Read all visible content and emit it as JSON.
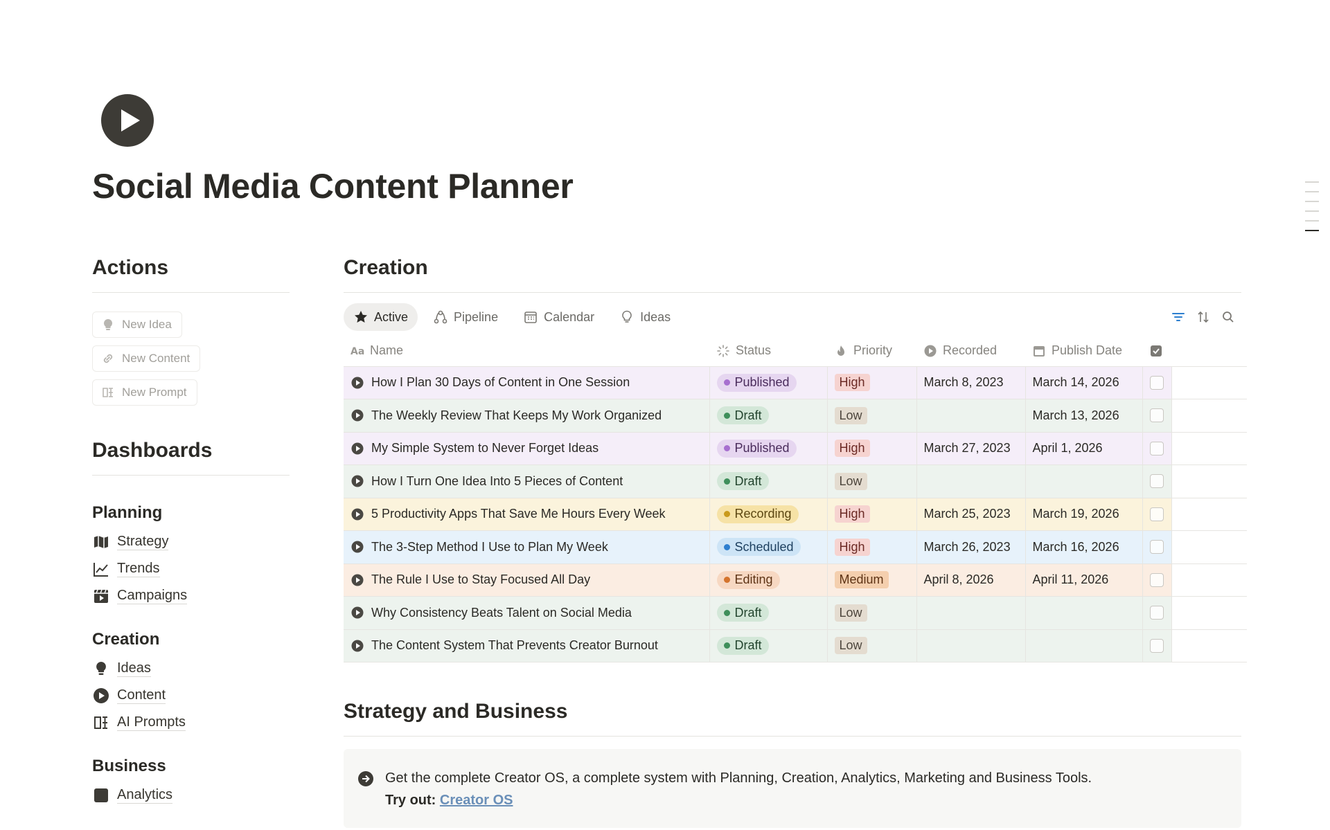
{
  "page": {
    "title": "Social Media Content Planner",
    "icon": "play-circle-icon"
  },
  "actions": {
    "heading": "Actions",
    "buttons": [
      {
        "label": "New Idea",
        "icon": "lightbulb-icon"
      },
      {
        "label": "New Content",
        "icon": "link-icon"
      },
      {
        "label": "New Prompt",
        "icon": "prompt-icon"
      }
    ]
  },
  "dashboards": {
    "heading": "Dashboards",
    "sections": [
      {
        "title": "Planning",
        "links": [
          {
            "label": "Strategy",
            "icon": "map-icon"
          },
          {
            "label": "Trends",
            "icon": "trend-up-icon"
          },
          {
            "label": "Campaigns",
            "icon": "clapperboard-icon"
          }
        ]
      },
      {
        "title": "Creation",
        "links": [
          {
            "label": "Ideas",
            "icon": "lightbulb-icon"
          },
          {
            "label": "Content",
            "icon": "play-circle-icon"
          },
          {
            "label": "AI Prompts",
            "icon": "prompt-icon"
          }
        ]
      },
      {
        "title": "Business",
        "links": [
          {
            "label": "Analytics",
            "icon": "chart-icon"
          }
        ]
      }
    ]
  },
  "creation": {
    "heading": "Creation",
    "views": [
      {
        "label": "Active",
        "icon": "star-icon",
        "active": true
      },
      {
        "label": "Pipeline",
        "icon": "pipeline-icon",
        "active": false
      },
      {
        "label": "Calendar",
        "icon": "calendar-icon",
        "active": false
      },
      {
        "label": "Ideas",
        "icon": "lightbulb-icon",
        "active": false
      }
    ],
    "columns": {
      "name": "Name",
      "status": "Status",
      "priority": "Priority",
      "recorded": "Recorded",
      "publish": "Publish Date"
    },
    "rows": [
      {
        "name": "How I Plan 30 Days of Content in One Session",
        "status": "Published",
        "priority": "High",
        "recorded": "March 8, 2023",
        "publish": "March 14, 2026"
      },
      {
        "name": "The Weekly Review That Keeps My Work Organized",
        "status": "Draft",
        "priority": "Low",
        "recorded": "",
        "publish": "March 13, 2026"
      },
      {
        "name": "My Simple System to Never Forget Ideas",
        "status": "Published",
        "priority": "High",
        "recorded": "March 27, 2023",
        "publish": "April 1, 2026"
      },
      {
        "name": "How I Turn One Idea Into 5 Pieces of Content",
        "status": "Draft",
        "priority": "Low",
        "recorded": "",
        "publish": ""
      },
      {
        "name": "5 Productivity Apps That Save Me Hours Every Week",
        "status": "Recording",
        "priority": "High",
        "recorded": "March 25, 2023",
        "publish": "March 19, 2026"
      },
      {
        "name": "The 3-Step Method I Use to Plan My Week",
        "status": "Scheduled",
        "priority": "High",
        "recorded": "March 26, 2023",
        "publish": "March 16, 2026"
      },
      {
        "name": "The Rule I Use to Stay Focused All Day",
        "status": "Editing",
        "priority": "Medium",
        "recorded": "April 8, 2026",
        "publish": "April 11, 2026"
      },
      {
        "name": "Why Consistency Beats Talent on Social Media",
        "status": "Draft",
        "priority": "Low",
        "recorded": "",
        "publish": ""
      },
      {
        "name": "The Content System That Prevents Creator Burnout",
        "status": "Draft",
        "priority": "Low",
        "recorded": "",
        "publish": ""
      }
    ],
    "status_colors": {
      "Published": {
        "row": "#f5eef9",
        "pill": "#e6d6f0",
        "dot": "#a76fcf",
        "text": "#4a2c5c"
      },
      "Draft": {
        "row": "#edf3ee",
        "pill": "#d3e7d8",
        "dot": "#3f8f5b",
        "text": "#23452e"
      },
      "Recording": {
        "row": "#fbf3dc",
        "pill": "#f6e2a6",
        "dot": "#c99a1b",
        "text": "#5c4712"
      },
      "Scheduled": {
        "row": "#e7f2fb",
        "pill": "#cde4f6",
        "dot": "#2e7fcf",
        "text": "#1d3f5f"
      },
      "Editing": {
        "row": "#fbede2",
        "pill": "#f7d8c2",
        "dot": "#d4742d",
        "text": "#5e3416"
      }
    },
    "priority_colors": {
      "High": {
        "bg": "#f6d3d0",
        "text": "#6b2a25"
      },
      "Low": {
        "bg": "#e4dcd0",
        "text": "#4d463d"
      },
      "Medium": {
        "bg": "#f4cfae",
        "text": "#5e3416"
      }
    }
  },
  "strategy": {
    "heading": "Strategy and Business",
    "callout_text": "Get the complete Creator OS, a complete system with Planning, Creation, Analytics, Marketing and Business Tools.",
    "try_label": "Try out:",
    "link_text": "Creator OS"
  }
}
